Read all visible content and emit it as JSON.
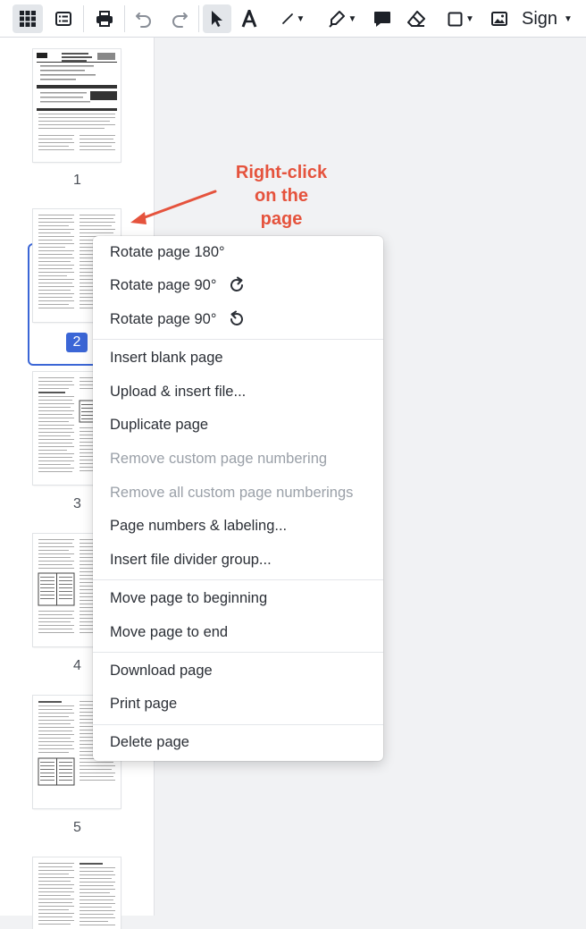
{
  "toolbar": {
    "sign_label": "Sign"
  },
  "thumbnails": {
    "numbers": [
      "1",
      "2",
      "3",
      "4",
      "5"
    ],
    "selected_number": "2"
  },
  "annotation": {
    "line1": "Right-click",
    "line2": "on the",
    "line3": "page"
  },
  "context_menu": {
    "rotate_180": "Rotate page 180°",
    "rotate_90_cw": "Rotate page 90°",
    "rotate_90_ccw": "Rotate page 90°",
    "insert_blank": "Insert blank page",
    "upload_insert": "Upload & insert file...",
    "duplicate": "Duplicate page",
    "remove_custom_numbering": "Remove custom page numbering",
    "remove_all_custom_numberings": "Remove all custom page numberings",
    "page_numbers_labeling": "Page numbers & labeling...",
    "insert_divider": "Insert file divider group...",
    "move_beginning": "Move page to beginning",
    "move_end": "Move page to end",
    "download": "Download page",
    "print": "Print page",
    "delete": "Delete page"
  },
  "colors": {
    "accent": "#3b66d6",
    "annotation": "#e5533d",
    "disabled_text": "#9aa0a8"
  }
}
